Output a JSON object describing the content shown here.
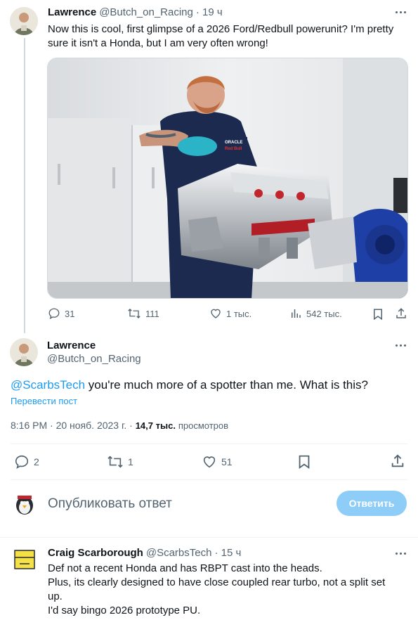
{
  "tweet1": {
    "name": "Lawrence",
    "handle": "@Butch_on_Racing",
    "time": "· 19 ч",
    "text_line1": "Now this is cool, first glimpse of a 2026 Ford/Redbull powerunit? I'm pretty",
    "text_line2": "sure it isn't a Honda, but I am very often wrong!",
    "stats": {
      "replies": "31",
      "retweets": "111",
      "likes": "1 тыс.",
      "views": "542 тыс."
    }
  },
  "tweet2": {
    "name": "Lawrence",
    "handle": "@Butch_on_Racing",
    "mention": "@ScarbsTech",
    "text": " you're much more of a spotter than me. What is this?",
    "translate": "Перевести пост",
    "timestamp": "8:16 PM · 20 нояб. 2023 г. ·",
    "views_count": "14,7 тыс.",
    "views_label": "просмотров",
    "stats": {
      "replies": "2",
      "retweets": "1",
      "likes": "51"
    }
  },
  "composer": {
    "placeholder": "Опубликовать ответ",
    "button": "Ответить"
  },
  "reply": {
    "name": "Craig Scarborough",
    "handle": "@ScarbsTech",
    "time": "· 15 ч",
    "line1": "Def not a recent Honda and has RBPT cast into the heads.",
    "line2": "Plus, its clearly designed to have close coupled rear turbo, not a split set",
    "line3": "up.",
    "line4": "I'd say bingo 2026 prototype PU."
  },
  "photo_badge": {
    "line1": "ORACLE",
    "line2": "Red Bull"
  },
  "colors": {
    "accent": "#1d9bf0",
    "muted": "#536471",
    "divider": "#eff3f4"
  }
}
